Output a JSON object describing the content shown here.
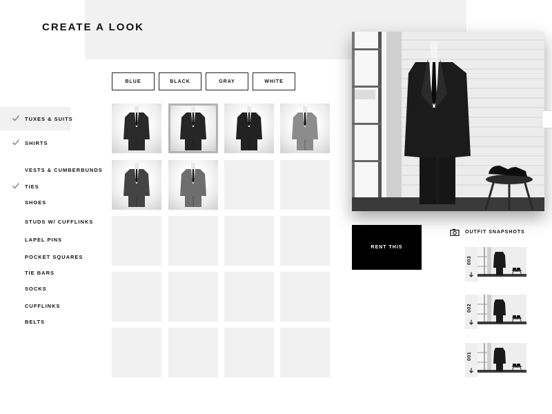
{
  "page": {
    "title": "CREATE A LOOK"
  },
  "sidebar": {
    "items": [
      {
        "label": "TUXES & SUITS",
        "checked": true,
        "active": true
      },
      {
        "label": "SHIRTS",
        "checked": true,
        "active": false
      },
      {
        "label": "VESTS & CUMBERBUNDS",
        "checked": false,
        "active": false
      },
      {
        "label": "TIES",
        "checked": true,
        "active": false
      },
      {
        "label": "SHOES",
        "checked": false,
        "active": false
      },
      {
        "label": "STUDS W/ CUFFLINKS",
        "checked": false,
        "active": false
      },
      {
        "label": "LAPEL PINS",
        "checked": false,
        "active": false
      },
      {
        "label": "POCKET SQUARES",
        "checked": false,
        "active": false
      },
      {
        "label": "TIE BARS",
        "checked": false,
        "active": false
      },
      {
        "label": "SOCKS",
        "checked": false,
        "active": false
      },
      {
        "label": "CUFFLINKS",
        "checked": false,
        "active": false
      },
      {
        "label": "BELTS",
        "checked": false,
        "active": false
      }
    ]
  },
  "filters": {
    "colors": [
      "BLUE",
      "BLACK",
      "GRAY",
      "WHITE"
    ]
  },
  "grid": {
    "products": [
      {
        "suit": "#2a2a2a",
        "selected": false
      },
      {
        "suit": "#262626",
        "selected": true
      },
      {
        "suit": "#222222",
        "selected": false
      },
      {
        "suit": "#8c8c8c",
        "selected": false
      },
      {
        "suit": "#444444",
        "selected": false
      },
      {
        "suit": "#6e6e6e",
        "selected": false
      }
    ],
    "empty_tiles": 14
  },
  "actions": {
    "rent_label": "RENT THIS"
  },
  "snapshots": {
    "header": "OUTFIT SNAPSHOTS",
    "items": [
      {
        "number": "003"
      },
      {
        "number": "002"
      },
      {
        "number": "001"
      }
    ]
  },
  "colors": {
    "accent": "#000000",
    "panel": "#f1f1f1",
    "selected_border": "#b3b3b3"
  }
}
